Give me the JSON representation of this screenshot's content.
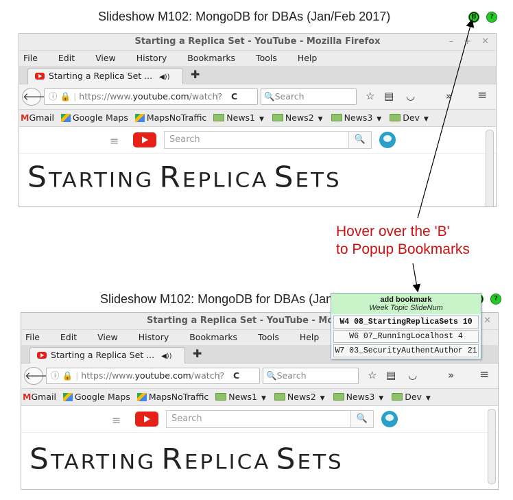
{
  "slide": {
    "title": "Slideshow M102: MongoDB for DBAs (Jan/Feb 2017)",
    "title_truncated": "Slideshow M102: MongoDB for DBAs (Jan/Feb 2017)",
    "badge_b": "B",
    "badge_help": "?"
  },
  "browser": {
    "window_title": "Starting a Replica Set - YouTube - Mozilla Firefox",
    "window_title_short": "Starting a Replica Set - YouTube - Mozil",
    "win_min": "–",
    "win_max": "+",
    "win_close": "✕",
    "menu": [
      "File",
      "Edit",
      "View",
      "History",
      "Bookmarks",
      "Tools",
      "Help"
    ],
    "tab_label": "Starting a Replica Set ...",
    "tab_audio": "◀))",
    "tab_close": "✕",
    "new_tab": "✚",
    "url_prefix": "https://www.",
    "url_domain": "youtube.com",
    "url_path": "/watch?",
    "search_placeholder": "Search",
    "reload": "C",
    "bookmarks_toolbar": [
      "Gmail",
      "Google Maps",
      "MapsNoTraffic",
      "News1",
      "News2",
      "News3",
      "Dev"
    ]
  },
  "youtube": {
    "search_placeholder": "Search",
    "search_icon": "magnifier-icon",
    "video_title_handwritten": "STARTING REPLICA SETS"
  },
  "annotation": {
    "line1": "Hover over the 'B'",
    "line2": "to Popup Bookmarks"
  },
  "popup": {
    "header": "add bookmark",
    "subheader": "Week Topic SlideNum",
    "items": [
      "W4 08_StartingReplicaSets 10",
      "W6 07_RunningLocalhost 4",
      "W7 03_SecurityAuthentAuthor 21"
    ]
  },
  "colors": {
    "accent_red": "#cc1111",
    "badge_green": "#22cc22",
    "youtube_red": "#e62117",
    "popup_header": "#c9f3c9"
  }
}
